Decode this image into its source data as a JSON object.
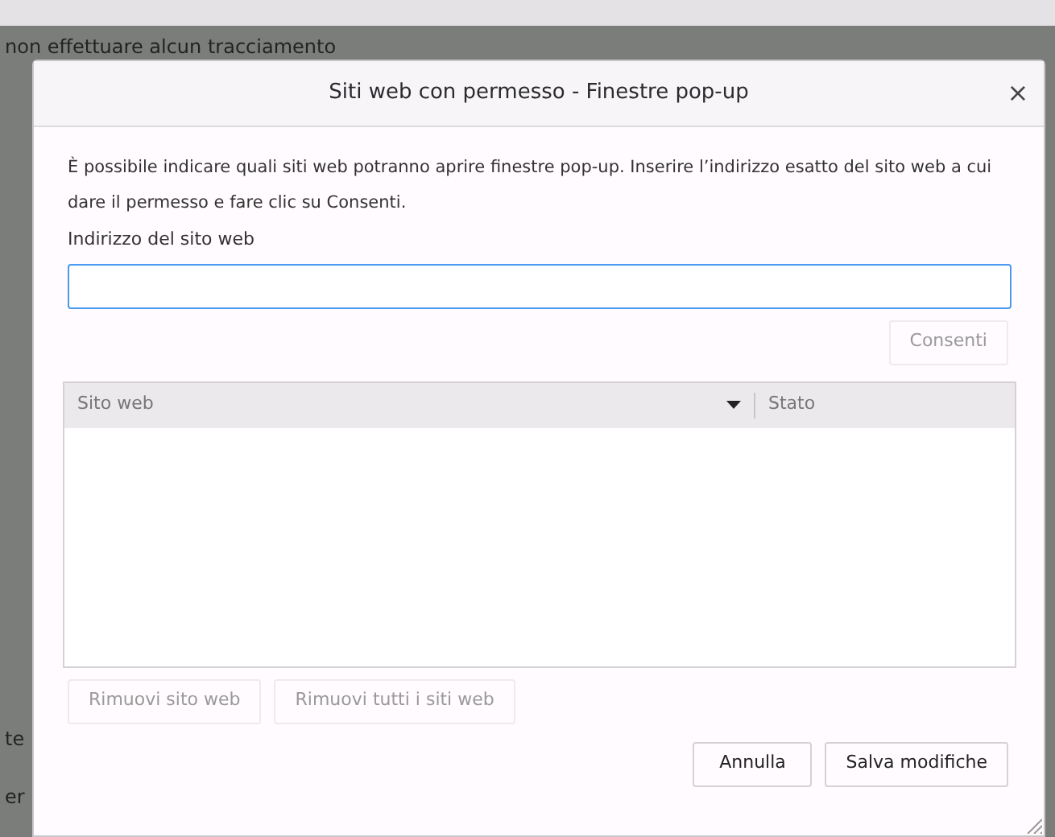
{
  "background": {
    "texts": [
      "non effettuare alcun tracciamento",
      "te",
      "er"
    ]
  },
  "dialog": {
    "title": "Siti web con permesso - Finestre pop-up",
    "close": "×",
    "description": "È possibile indicare quali siti web potranno aprire finestre pop-up. Inserire l’indirizzo esatto del sito web a cui dare il permesso e fare clic su Consenti.",
    "address_label": {
      "text": "Indirizzo del sito web"
    },
    "allow_button": {
      "label": "Consenti",
      "disabled": true
    },
    "table": {
      "columns": [
        {
          "label": "Sito web",
          "sorted": true
        },
        {
          "label": "Stato",
          "sorted": false
        }
      ]
    },
    "remove_buttons": [
      {
        "label": "Rimuovi sito web",
        "disabled": true
      },
      {
        "label": "Rimuovi tutti i siti web",
        "disabled": true
      }
    ],
    "footer_buttons": [
      {
        "label": "Annulla",
        "disabled": false
      },
      {
        "label": "Salva modifiche",
        "disabled": false
      }
    ]
  }
}
